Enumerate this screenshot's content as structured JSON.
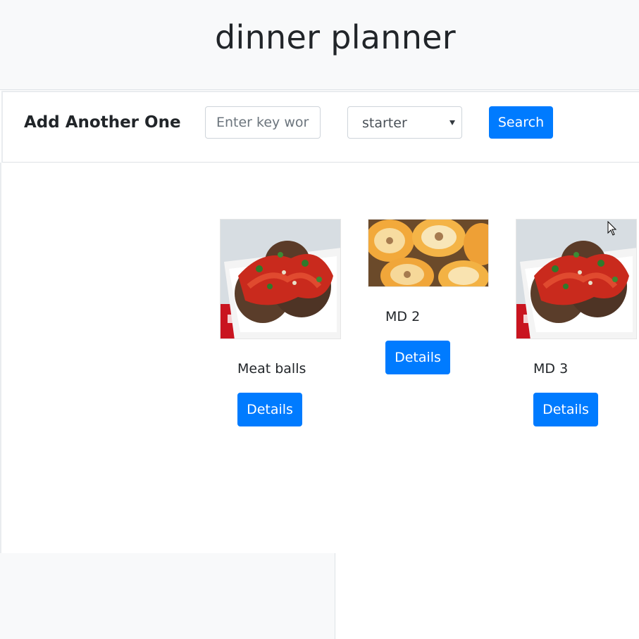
{
  "app": {
    "title": "dinner planner"
  },
  "search": {
    "heading": "Add Another One",
    "keyword_placeholder": "Enter key word",
    "keyword_value": "",
    "type_selected": "starter",
    "button_label": "Search"
  },
  "dishes": [
    {
      "name": "Meat balls",
      "details_label": "Details",
      "image": "meatballs-photo"
    },
    {
      "name": "MD 2",
      "details_label": "Details",
      "image": "baked-peaches-photo"
    },
    {
      "name": "MD 3",
      "details_label": "Details",
      "image": "meatballs-photo"
    }
  ],
  "colors": {
    "primary": "#007bff",
    "header_bg": "#f8f9fa",
    "text": "#212529"
  }
}
